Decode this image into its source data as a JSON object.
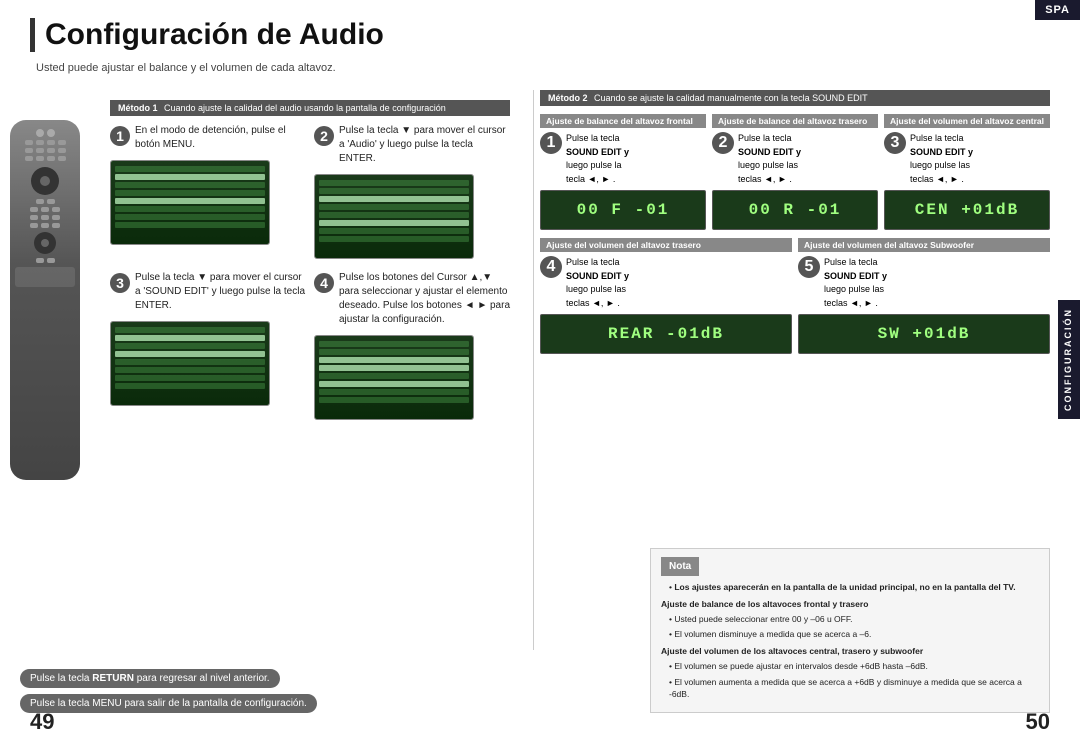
{
  "title": "Configuración de Audio",
  "subtitle": "Usted puede ajustar el balance y el volumen de cada altavoz.",
  "spa_badge": "SPA",
  "configuracion_label": "CONFIGURACIÓN",
  "page_left": "49",
  "page_right": "50",
  "method1": {
    "banner": "Método 1",
    "banner_text": "Cuando ajuste la calidad del audio usando la pantalla de configuración",
    "steps": [
      {
        "num": "1",
        "text": "En el modo de detención, pulse el botón MENU."
      },
      {
        "num": "2",
        "text": "Pulse la tecla ▼ para mover el cursor a 'Audio' y luego pulse la tecla ENTER."
      },
      {
        "num": "3",
        "text": "Pulse la tecla ▼ para mover el cursor a 'SOUND EDIT' y luego pulse la tecla ENTER."
      },
      {
        "num": "4",
        "text": "Pulse los botones del Cursor ▲,▼ para seleccionar y ajustar el elemento deseado. Pulse los botones ◄ ► para ajustar la configuración."
      }
    ]
  },
  "method2": {
    "banner": "Método 2",
    "banner_text": "Cuando se ajuste la calidad manualmente con la tecla SOUND EDIT",
    "sections_top": [
      {
        "header": "Ajuste de balance del altavoz frontal",
        "step_num": "1",
        "text_line1": "Pulse la tecla",
        "text_line2": "SOUND EDIT y",
        "text_line3": "luego pulse la",
        "text_line4": "tecla ◄, ► .",
        "display": "00 F -01"
      },
      {
        "header": "Ajuste de balance del altavoz trasero",
        "step_num": "2",
        "text_line1": "Pulse la tecla",
        "text_line2": "SOUND EDIT y",
        "text_line3": "luego pulse las",
        "text_line4": "teclas ◄, ► .",
        "display": "00 R -01"
      },
      {
        "header": "Ajuste del volumen del altavoz central",
        "step_num": "3",
        "text_line1": "Pulse la tecla",
        "text_line2": "SOUND EDIT y",
        "text_line3": "luego pulse las",
        "text_line4": "teclas ◄, ► .",
        "display": "CEN +01dB"
      }
    ],
    "sections_bottom": [
      {
        "header": "Ajuste del volumen del altavoz trasero",
        "step_num": "4",
        "text_line1": "Pulse la tecla",
        "text_line2": "SOUND EDIT y",
        "text_line3": "luego pulse las",
        "text_line4": "teclas ◄, ► .",
        "display": "REAR -01dB"
      },
      {
        "header": "Ajuste del volumen del altavoz Subwoofer",
        "step_num": "5",
        "text_line1": "Pulse la tecla",
        "text_line2": "SOUND EDIT y",
        "text_line3": "luego pulse las",
        "text_line4": "teclas ◄, ► .",
        "display": "SW +01dB"
      }
    ]
  },
  "return_note": "Pulse la tecla RETURN para regresar al nivel anterior.",
  "menu_note": "Pulse la tecla MENU para salir de la pantalla de configuración.",
  "nota": {
    "title": "Nota",
    "bullet1": "Los ajustes aparecerán en la pantalla de la unidad principal, no en la pantalla del TV.",
    "section1_title": "Ajuste de balance de los altavoces frontal y trasero",
    "section1_b1": "Usted puede seleccionar entre 00 y –06 u OFF.",
    "section1_b2": "El volumen disminuye a medida que se acerca a –6.",
    "section2_title": "Ajuste del volumen de los altavoces central, trasero y subwoofer",
    "section2_b1": "El volumen se puede ajustar en intervalos desde +6dB hasta –6dB.",
    "section2_b2": "El volumen aumenta a medida que se acerca a +6dB y disminuye a medida que se acerca a -6dB."
  }
}
